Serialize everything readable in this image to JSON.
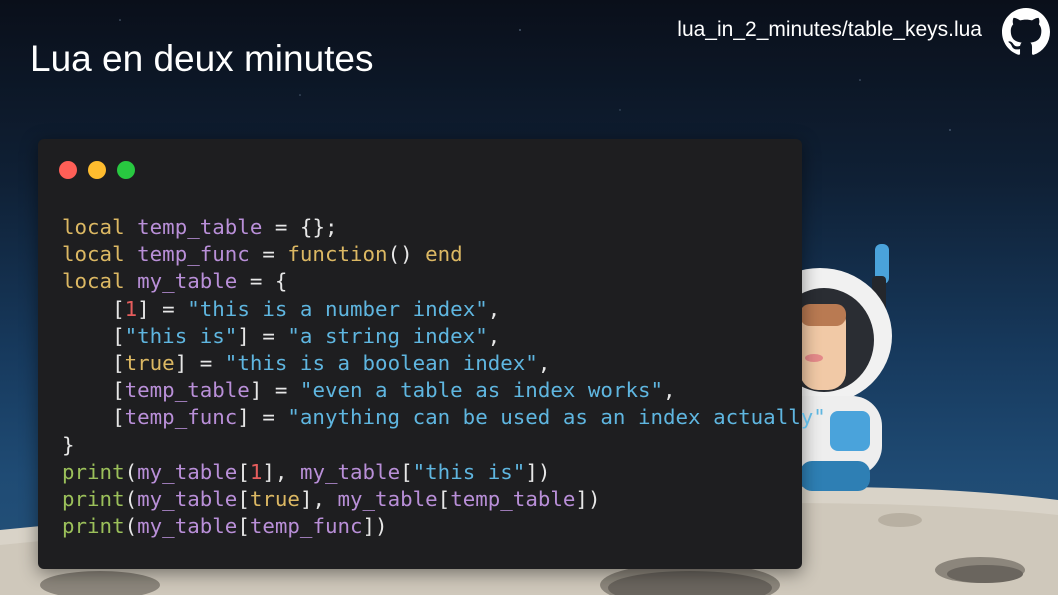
{
  "header": {
    "title": "Lua en deux minutes",
    "file_path": "lua_in_2_minutes/table_keys.lua",
    "github_icon": "github-icon"
  },
  "window": {
    "dots": [
      {
        "name": "close-dot",
        "color": "#ff5f57"
      },
      {
        "name": "minimize-dot",
        "color": "#febc2e"
      },
      {
        "name": "maximize-dot",
        "color": "#28c840"
      }
    ]
  },
  "code": {
    "lines": [
      [
        [
          "k",
          "local"
        ],
        [
          "p",
          " "
        ],
        [
          "v",
          "temp_table"
        ],
        [
          "p",
          " = {};"
        ]
      ],
      [
        [
          "k",
          "local"
        ],
        [
          "p",
          " "
        ],
        [
          "v",
          "temp_func"
        ],
        [
          "p",
          " = "
        ],
        [
          "k",
          "function"
        ],
        [
          "p",
          "() "
        ],
        [
          "k",
          "end"
        ]
      ],
      [
        [
          "k",
          "local"
        ],
        [
          "p",
          " "
        ],
        [
          "v",
          "my_table"
        ],
        [
          "p",
          " = {"
        ]
      ],
      [
        [
          "p",
          "    ["
        ],
        [
          "n",
          "1"
        ],
        [
          "p",
          "] = "
        ],
        [
          "s",
          "\"this is a number index\""
        ],
        [
          "p",
          ","
        ]
      ],
      [
        [
          "p",
          "    ["
        ],
        [
          "s",
          "\"this is\""
        ],
        [
          "p",
          "] = "
        ],
        [
          "s",
          "\"a string index\""
        ],
        [
          "p",
          ","
        ]
      ],
      [
        [
          "p",
          "    ["
        ],
        [
          "k",
          "true"
        ],
        [
          "p",
          "] = "
        ],
        [
          "s",
          "\"this is a boolean index\""
        ],
        [
          "p",
          ","
        ]
      ],
      [
        [
          "p",
          "    ["
        ],
        [
          "v",
          "temp_table"
        ],
        [
          "p",
          "] = "
        ],
        [
          "s",
          "\"even a table as index works\""
        ],
        [
          "p",
          ","
        ]
      ],
      [
        [
          "p",
          "    ["
        ],
        [
          "v",
          "temp_func"
        ],
        [
          "p",
          "] = "
        ],
        [
          "s",
          "\"anything can be used as an index actually\""
        ]
      ],
      [
        [
          "p",
          "}"
        ]
      ],
      [
        [
          "f",
          "print"
        ],
        [
          "p",
          "("
        ],
        [
          "v",
          "my_table"
        ],
        [
          "p",
          "["
        ],
        [
          "n",
          "1"
        ],
        [
          "p",
          "], "
        ],
        [
          "v",
          "my_table"
        ],
        [
          "p",
          "["
        ],
        [
          "s",
          "\"this is\""
        ],
        [
          "p",
          "])"
        ]
      ],
      [
        [
          "f",
          "print"
        ],
        [
          "p",
          "("
        ],
        [
          "v",
          "my_table"
        ],
        [
          "p",
          "["
        ],
        [
          "k",
          "true"
        ],
        [
          "p",
          "], "
        ],
        [
          "v",
          "my_table"
        ],
        [
          "p",
          "["
        ],
        [
          "v",
          "temp_table"
        ],
        [
          "p",
          "])"
        ]
      ],
      [
        [
          "f",
          "print"
        ],
        [
          "p",
          "("
        ],
        [
          "v",
          "my_table"
        ],
        [
          "p",
          "["
        ],
        [
          "v",
          "temp_func"
        ],
        [
          "p",
          "])"
        ]
      ]
    ]
  },
  "illustration": {
    "astronaut_icon": "astronaut-illustration",
    "moon_icon": "moon-surface"
  }
}
